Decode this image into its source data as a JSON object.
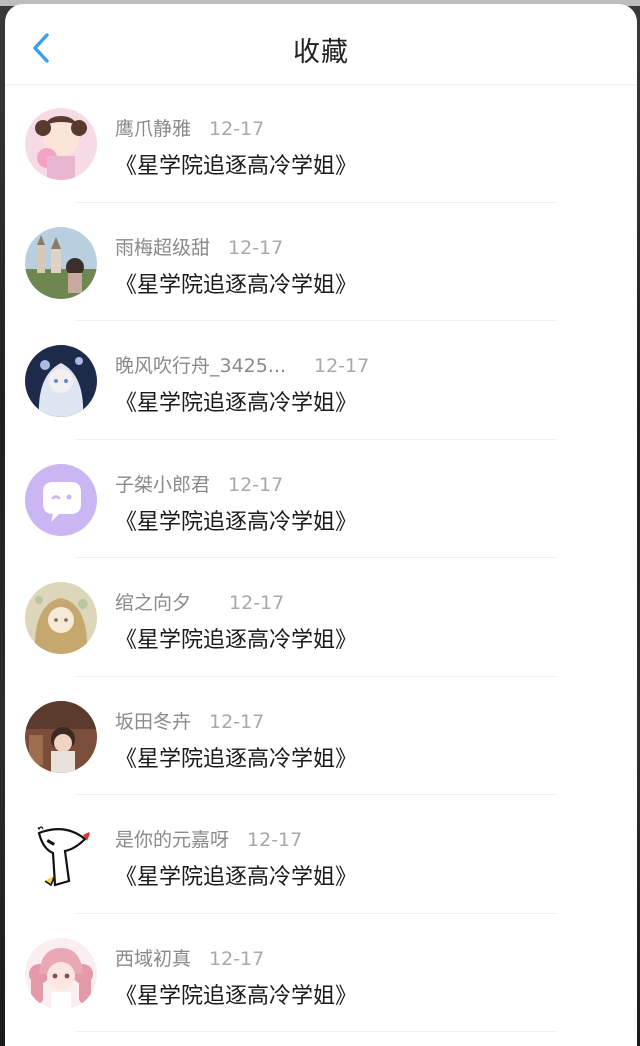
{
  "header": {
    "title": "收藏",
    "back_icon": "chevron-left-icon",
    "accent_color": "#3a9ee8"
  },
  "favorites": [
    {
      "user": "鹰爪静雅",
      "date": "12-17",
      "book": "《星学院追逐高冷学姐》",
      "avatar_colors": [
        "#f3cfe0",
        "#5a3a2e"
      ]
    },
    {
      "user": "雨梅超级甜",
      "date": "12-17",
      "book": "《星学院追逐高冷学姐》",
      "avatar_colors": [
        "#a9c3d8",
        "#6b7a4a"
      ]
    },
    {
      "user": "晚风吹行舟_3425...",
      "date": "12-17",
      "book": "《星学院追逐高冷学姐》",
      "avatar_colors": [
        "#1d2a4a",
        "#dfe6f2"
      ]
    },
    {
      "user": "子桀小郎君",
      "date": "12-17",
      "book": "《星学院追逐高冷学姐》",
      "avatar_colors": [
        "#c9b6f2",
        "#ffffff"
      ]
    },
    {
      "user": "绾之向夕",
      "date": "12-17",
      "book": "《星学院追逐高冷学姐》",
      "avatar_colors": [
        "#d9d2b4",
        "#b89a6a"
      ]
    },
    {
      "user": "坂田冬卉",
      "date": "12-17",
      "book": "《星学院追逐高冷学姐》",
      "avatar_colors": [
        "#8a5a44",
        "#f0d3c0"
      ]
    },
    {
      "user": "是你的元嘉呀",
      "date": "12-17",
      "book": "《星学院追逐高冷学姐》",
      "avatar_colors": [
        "#ffffff",
        "#111111"
      ]
    },
    {
      "user": "西域初真",
      "date": "12-17",
      "book": "《星学院追逐高冷学姐》",
      "avatar_colors": [
        "#f7d6dc",
        "#e39aa8"
      ]
    }
  ]
}
